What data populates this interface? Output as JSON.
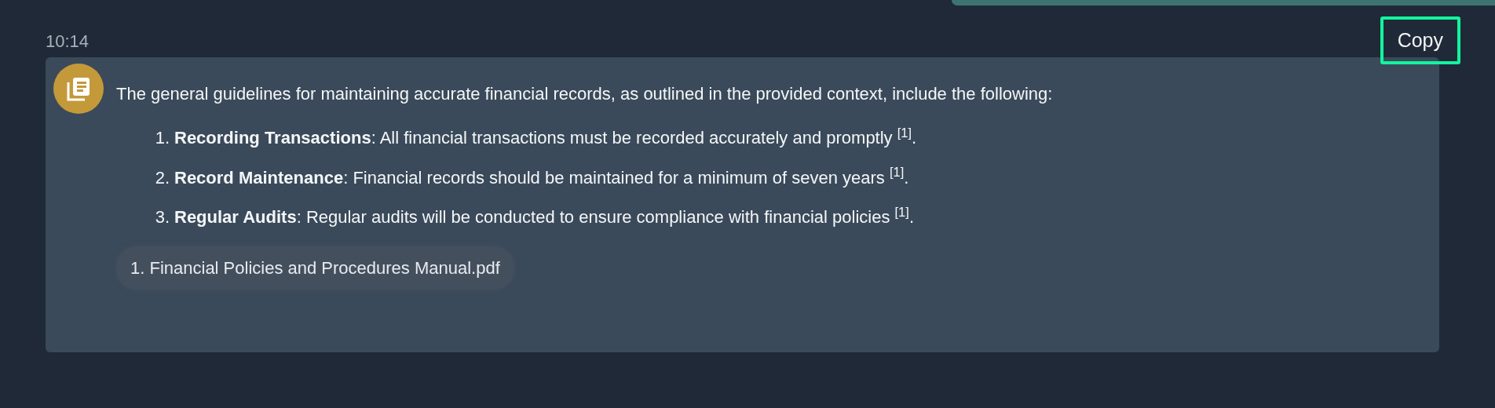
{
  "previous_message": {
    "kind": "bubble"
  },
  "message": {
    "time": "10:14",
    "copy_button": "Copy",
    "intro": "The general guidelines for maintaining accurate financial records, as outlined in the provided context, include the following:",
    "items": [
      {
        "number": "1.",
        "text": "**Recording Transactions**: All financial transactions must be recorded accurately and promptly $^{[1]}$."
      },
      {
        "number": "2.",
        "text": "**Record Maintenance**: Financial records should be maintained for a minimum of seven years $^{[1]}$."
      },
      {
        "number": "3.",
        "text": "**Regular Audits**: Regular audits will be conducted to ensure compliance with financial policies $^{[1]}$."
      }
    ],
    "sources": [
      "1. Financial Policies and Procedures Manual.pdf"
    ]
  }
}
